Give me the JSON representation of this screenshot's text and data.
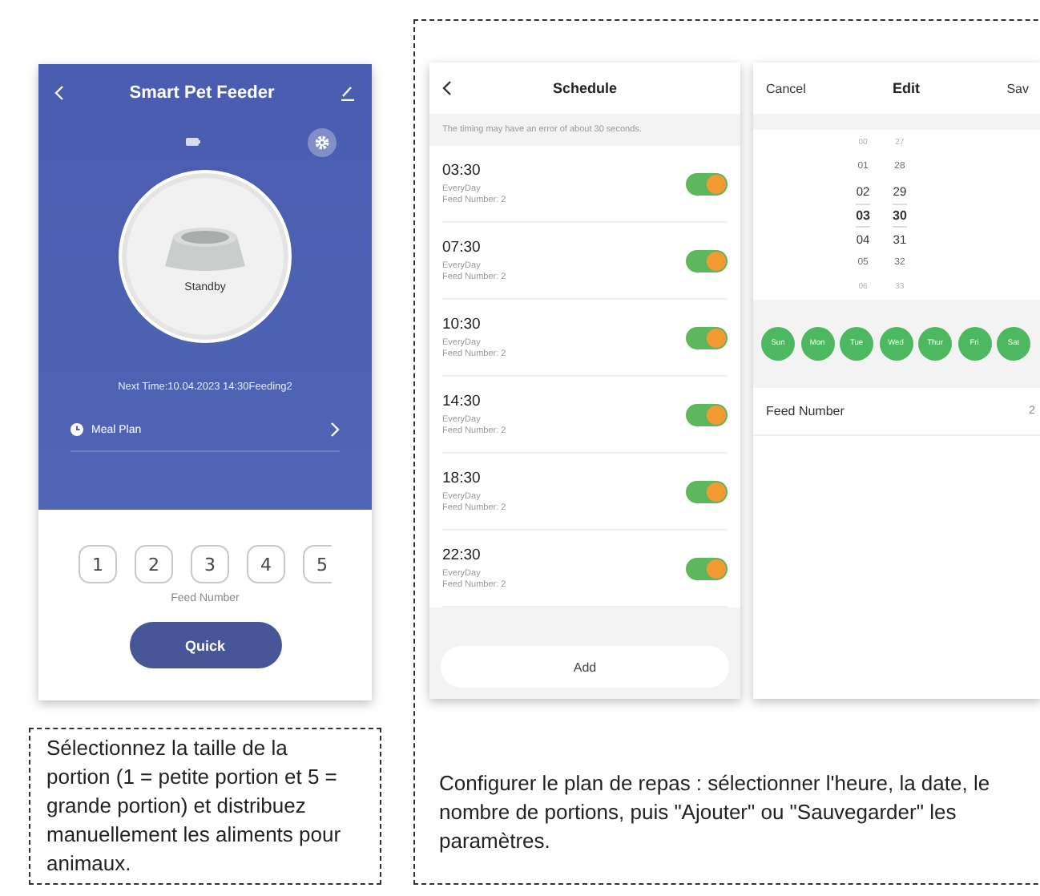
{
  "feeder": {
    "title": "Smart Pet Feeder",
    "status": "Standby",
    "next_time": "Next Time:10.04.2023 14:30Feeding2",
    "meal_plan": "Meal Plan",
    "portions": [
      {
        "label": "1"
      },
      {
        "label": "2"
      },
      {
        "label": "3"
      },
      {
        "label": "4"
      },
      {
        "label": "5"
      }
    ],
    "portions_label": "Feed Number",
    "quick_button": "Quick"
  },
  "feeder_caption": "Sélectionnez la taille de la portion (1 = petite portion et 5 = grande portion) et distribuez manuellement les aliments pour animaux.",
  "schedule": {
    "title": "Schedule",
    "notice": "The timing may have an error of about 30 seconds.",
    "items": [
      {
        "time": "03:30",
        "repeat": "EveryDay",
        "feed": "Feed Number: 2",
        "on": true
      },
      {
        "time": "07:30",
        "repeat": "EveryDay",
        "feed": "Feed Number: 2",
        "on": true
      },
      {
        "time": "10:30",
        "repeat": "EveryDay",
        "feed": "Feed Number: 2",
        "on": true
      },
      {
        "time": "14:30",
        "repeat": "EveryDay",
        "feed": "Feed Number: 2",
        "on": true
      },
      {
        "time": "18:30",
        "repeat": "EveryDay",
        "feed": "Feed Number: 2",
        "on": true
      },
      {
        "time": "22:30",
        "repeat": "EveryDay",
        "feed": "Feed Number: 2",
        "on": true
      }
    ],
    "add_button": "Add"
  },
  "edit": {
    "cancel": "Cancel",
    "title": "Edit",
    "save": "Sav",
    "hours": [
      {
        "label": "00",
        "selected": false
      },
      {
        "label": "01",
        "selected": false
      },
      {
        "label": "02",
        "selected": false
      },
      {
        "label": "03",
        "selected": true
      },
      {
        "label": "04",
        "selected": false
      },
      {
        "label": "05",
        "selected": false
      },
      {
        "label": "06",
        "selected": false
      }
    ],
    "minutes": [
      {
        "label": "27",
        "selected": false
      },
      {
        "label": "28",
        "selected": false
      },
      {
        "label": "29",
        "selected": false
      },
      {
        "label": "30",
        "selected": true
      },
      {
        "label": "31",
        "selected": false
      },
      {
        "label": "32",
        "selected": false
      },
      {
        "label": "33",
        "selected": false
      }
    ],
    "days": [
      {
        "label": "Sun",
        "selected": true
      },
      {
        "label": "Mon",
        "selected": true
      },
      {
        "label": "Tue",
        "selected": true
      },
      {
        "label": "Wed",
        "selected": true
      },
      {
        "label": "Thur",
        "selected": true
      },
      {
        "label": "Fri",
        "selected": true
      },
      {
        "label": "Sat",
        "selected": true
      }
    ],
    "feed_label": "Feed Number",
    "feed_value": "2"
  },
  "schedule_caption": "Configurer le plan de repas : sélectionner l'heure, la date, le nombre de portions, puis \"Ajouter\" ou \"Sauvegarder\" les paramètres."
}
